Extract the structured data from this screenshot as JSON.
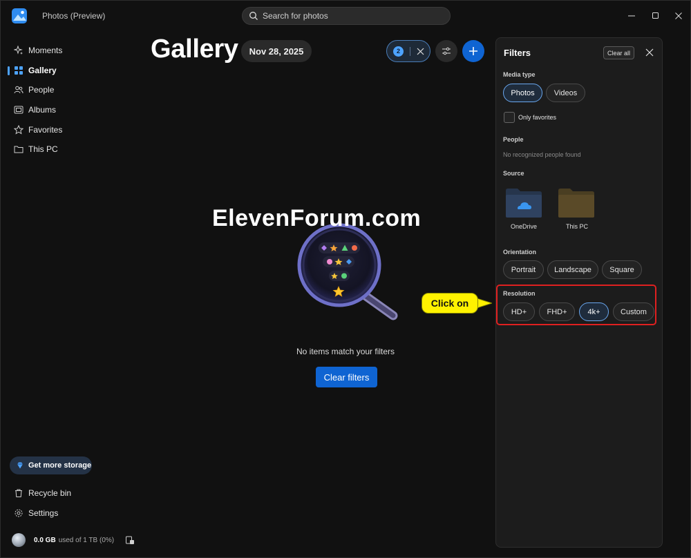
{
  "app": {
    "title": "Photos (Preview)"
  },
  "search": {
    "placeholder": "Search for photos"
  },
  "sidebar": {
    "items": [
      {
        "label": "Moments",
        "icon": "sparkle-icon"
      },
      {
        "label": "Gallery",
        "icon": "gallery-icon",
        "active": true
      },
      {
        "label": "People",
        "icon": "people-icon"
      },
      {
        "label": "Albums",
        "icon": "albums-icon"
      },
      {
        "label": "Favorites",
        "icon": "star-icon"
      },
      {
        "label": "This PC",
        "icon": "folder-icon"
      }
    ],
    "storage_button": "Get more storage",
    "bottom_items": [
      {
        "label": "Recycle bin",
        "icon": "trash-icon"
      },
      {
        "label": "Settings",
        "icon": "gear-icon"
      }
    ],
    "usage": {
      "used": "0.0 GB",
      "rest": "used of 1 TB (0%)"
    }
  },
  "header": {
    "title": "Gallery",
    "date": "Nov 28, 2025",
    "filter_count": "2"
  },
  "empty_state": {
    "message": "No items match your filters",
    "button": "Clear filters"
  },
  "watermark": "ElevenForum.com",
  "filters": {
    "title": "Filters",
    "clear_all": "Clear all",
    "media_type": {
      "label": "Media type",
      "options": [
        "Photos",
        "Videos"
      ],
      "selected": "Photos"
    },
    "only_favorites": "Only favorites",
    "people": {
      "label": "People",
      "empty": "No recognized people found"
    },
    "source": {
      "label": "Source",
      "options": [
        "OneDrive",
        "This PC"
      ]
    },
    "orientation": {
      "label": "Orientation",
      "options": [
        "Portrait",
        "Landscape",
        "Square"
      ]
    },
    "resolution": {
      "label": "Resolution",
      "options": [
        "HD+",
        "FHD+",
        "4k+",
        "Custom"
      ],
      "selected": "4k+"
    }
  },
  "annotation": {
    "callout": "Click on"
  },
  "colors": {
    "accent": "#4da3ff",
    "primary_button": "#0f64d2",
    "highlight": "#e02020",
    "callout": "#fff200"
  }
}
